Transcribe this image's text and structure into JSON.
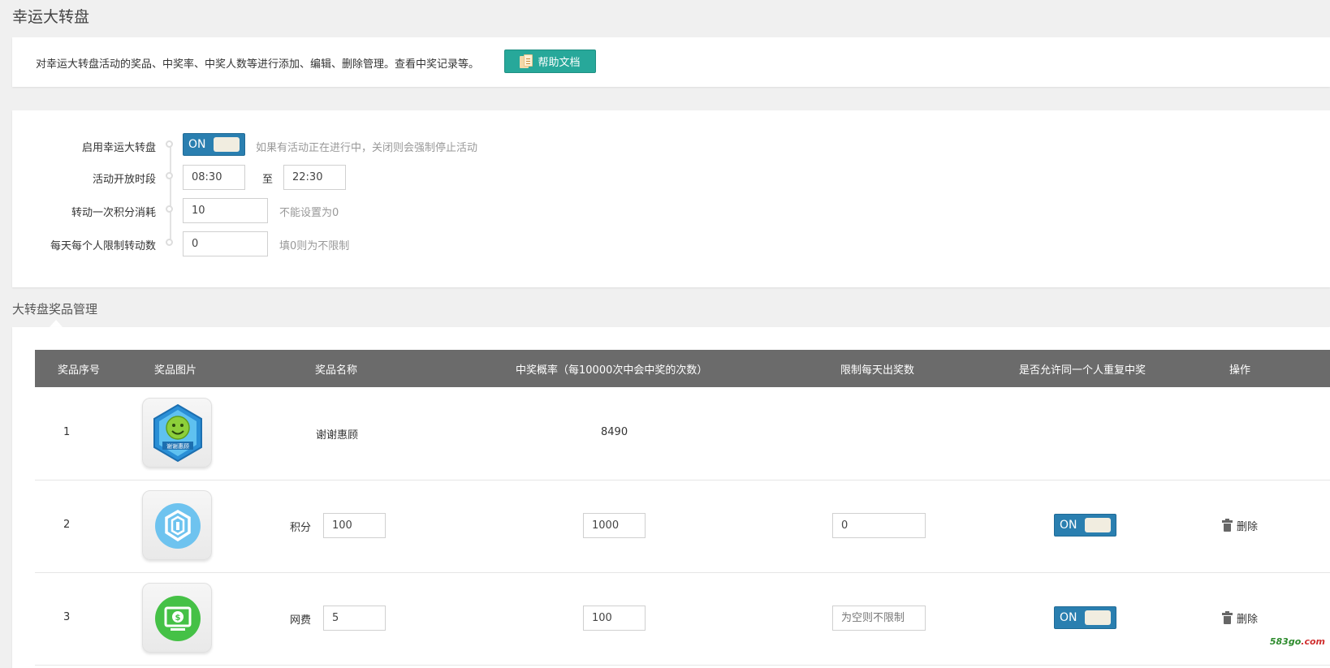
{
  "page": {
    "title": "幸运大转盘"
  },
  "intro": {
    "text": "对幸运大转盘活动的奖品、中奖率、中奖人数等进行添加、编辑、删除管理。查看中奖记录等。",
    "help_label": "帮助文档"
  },
  "settings": {
    "enable": {
      "label": "启用幸运大转盘",
      "toggle": "ON",
      "hint": "如果有活动正在进行中，关闭则会强制停止活动"
    },
    "period": {
      "label": "活动开放时段",
      "start": "08:30",
      "to": "至",
      "end": "22:30"
    },
    "cost": {
      "label": "转动一次积分消耗",
      "value": "10",
      "hint": "不能设置为0"
    },
    "limit": {
      "label": "每天每个人限制转动数",
      "value": "0",
      "hint": "填0则为不限制"
    }
  },
  "prizes": {
    "section_title": "大转盘奖品管理",
    "columns": [
      "奖品序号",
      "奖品图片",
      "奖品名称",
      "中奖概率（每10000次中会中奖的次数）",
      "限制每天出奖数",
      "是否允许同一个人重复中奖",
      "操作"
    ],
    "rows": [
      {
        "index": "1",
        "icon": "thank-you-badge-icon",
        "badge_text": "谢谢惠顾",
        "name": "谢谢惠顾",
        "probability": "8490"
      },
      {
        "index": "2",
        "icon": "points-shield-icon",
        "name": "积分",
        "amount": "100",
        "probability": "1000",
        "daily_limit": "0",
        "repeat": "ON",
        "action": "删除"
      },
      {
        "index": "3",
        "icon": "phone-fee-icon",
        "name": "网费",
        "amount": "5",
        "probability": "100",
        "daily_limit_placeholder": "为空则不限制",
        "repeat": "ON",
        "action": "删除"
      }
    ]
  },
  "watermark": {
    "main": "583go",
    "suffix": ".com"
  },
  "colors": {
    "accent": "#2a7fb0",
    "help_button": "#27a89a",
    "table_header": "#6b6b6b"
  }
}
